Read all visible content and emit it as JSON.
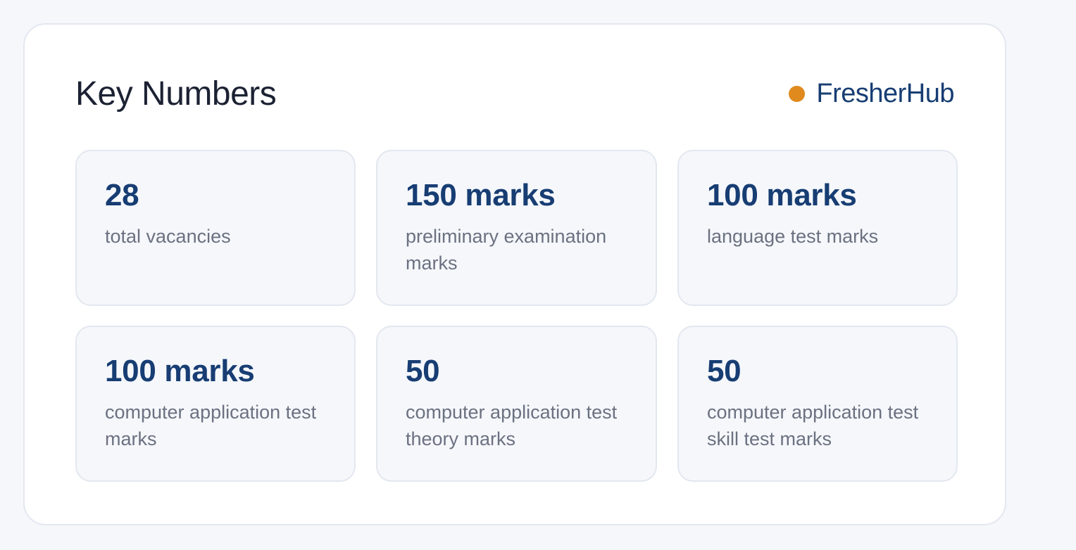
{
  "header": {
    "title": "Key Numbers",
    "brand": "FresherHub"
  },
  "colors": {
    "accent_dot": "#e08a1e",
    "brand_blue": "#173d73"
  },
  "stats": [
    {
      "value": "28",
      "label": "total vacancies"
    },
    {
      "value": "150 marks",
      "label": "preliminary examination marks"
    },
    {
      "value": "100 marks",
      "label": "language test marks"
    },
    {
      "value": "100 marks",
      "label": "computer application test marks"
    },
    {
      "value": "50",
      "label": "computer application test theory marks"
    },
    {
      "value": "50",
      "label": "computer application test skill test marks"
    }
  ]
}
